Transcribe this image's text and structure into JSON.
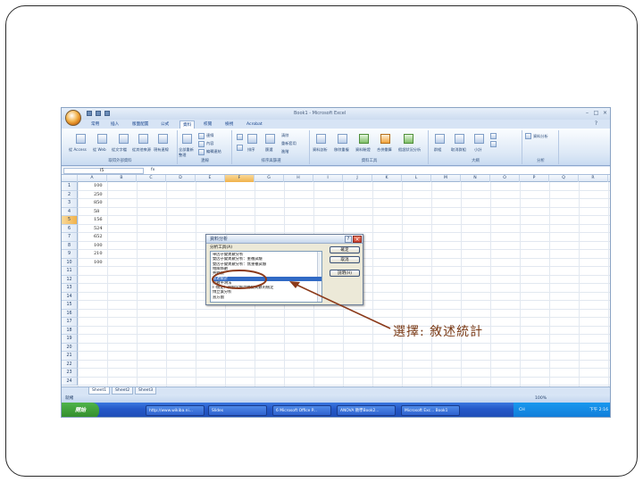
{
  "excel": {
    "window_title": "Book1 - Microsoft Excel",
    "tabs": [
      {
        "label": "常用"
      },
      {
        "label": "插入"
      },
      {
        "label": "版面配置"
      },
      {
        "label": "公式"
      },
      {
        "label": "資料",
        "active": true
      },
      {
        "label": "校閱"
      },
      {
        "label": "檢視"
      },
      {
        "label": "Acrobat"
      }
    ],
    "ribbon": {
      "groups": [
        {
          "label": "取得外部資料",
          "buttons": [
            "從 Access",
            "從 Web",
            "從文字檔",
            "從其他來源",
            "現有連線"
          ]
        },
        {
          "label": "連線",
          "buttons": [
            "全部重新整理",
            "連線",
            "內容",
            "編輯連結"
          ]
        },
        {
          "label": "排序與篩選",
          "buttons": [
            "排序",
            "篩選",
            "清除",
            "重新套用",
            "進階"
          ]
        },
        {
          "label": "資料工具",
          "buttons": [
            "資料剖析",
            "移除重複",
            "資料驗證",
            "合併彙算",
            "假設狀況分析"
          ]
        },
        {
          "label": "大綱",
          "buttons": [
            "群組",
            "取消群組",
            "小計"
          ]
        },
        {
          "label": "分析",
          "buttons": [
            "資料分析"
          ]
        }
      ]
    },
    "name_box": "I5",
    "formula_label": "fx",
    "columns": [
      "A",
      "B",
      "C",
      "D",
      "E",
      "F",
      "G",
      "H",
      "I",
      "J",
      "K",
      "L",
      "M",
      "N",
      "O",
      "P",
      "Q",
      "R"
    ],
    "selected_column": "F",
    "selected_row": "5",
    "rows": [
      "1",
      "2",
      "3",
      "4",
      "5",
      "6",
      "7",
      "8",
      "9",
      "10",
      "11",
      "12",
      "13",
      "14",
      "15",
      "16",
      "17",
      "18",
      "19",
      "20",
      "21",
      "22",
      "23",
      "24"
    ],
    "column_a_values": [
      "100",
      "250",
      "850",
      "58",
      "156",
      "524",
      "652",
      "100",
      "210",
      "100"
    ],
    "sheet_tabs": [
      "Sheet1",
      "Sheet2",
      "Sheet3"
    ],
    "status_text": "就緒",
    "zoom": "100%",
    "taskbar": {
      "start_label": "開始",
      "items": [
        {
          "label": "http://www.wikiba.ni..."
        },
        {
          "label": "Slides"
        },
        {
          "label": "6 Microsoft Office P..."
        },
        {
          "label": "ANOVA 教學Book2..."
        },
        {
          "label": "Microsoft Exc... Book1"
        }
      ],
      "clock": "下午 2:16",
      "tray_lang": "CH"
    }
  },
  "dialog": {
    "title": "資料分析",
    "list_label": "分析工具(A)",
    "items": [
      "單因子變異數分析",
      "雙因子變異數分析：重複試驗",
      "雙因子變異數分析：無重複試驗",
      "相關係數",
      "共變數",
      "敘述統計",
      "指數平滑法",
      "F-檢定：兩個常態母體變異數的檢定",
      "傅立葉分析",
      "直方圖"
    ],
    "selected_index": 5,
    "buttons": {
      "ok": "確定",
      "cancel": "取消",
      "help": "說明(H)"
    }
  },
  "annotation": {
    "callout_text": "選擇: 敘述統計",
    "color": "#8b3a1a"
  }
}
